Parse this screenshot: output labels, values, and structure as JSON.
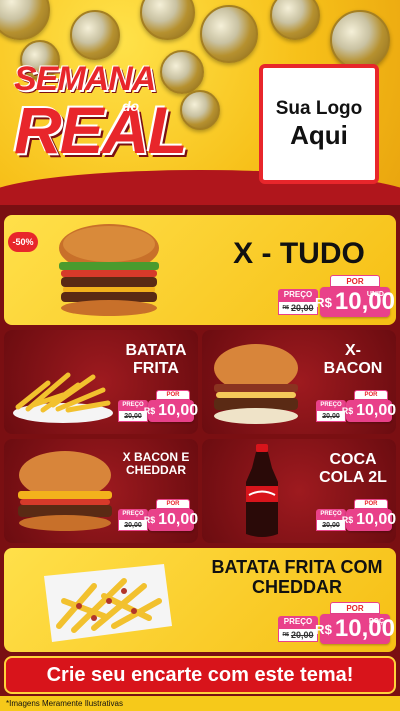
{
  "header": {
    "title_line1": "SEMANA",
    "title_de": "do",
    "title_line2": "REAL",
    "logo_line1": "Sua Logo",
    "logo_line2": "Aqui"
  },
  "products": {
    "xtudo": {
      "name": "X - TUDO",
      "discount": "-50%",
      "label_preco": "PREÇO",
      "label_por": "POR",
      "old_price": "20,00",
      "old_prefix": "R$",
      "new_prefix": "R$",
      "new_price": "10,00",
      "unit": "UNID"
    },
    "batata": {
      "name_line1": "BATATA",
      "name_line2": "FRITA",
      "label_preco": "PREÇO",
      "label_por": "POR",
      "old_price": "20,00",
      "new_prefix": "R$",
      "new_price": "10,00"
    },
    "xbacon": {
      "name_line1": "X-",
      "name_line2": "BACON",
      "label_preco": "PREÇO",
      "label_por": "POR",
      "old_price": "20,00",
      "new_prefix": "R$",
      "new_price": "10,00"
    },
    "xbaconcheddar": {
      "name_line1": "X BACON E",
      "name_line2": "CHEDDAR",
      "label_preco": "PREÇO",
      "label_por": "POR",
      "old_price": "20,00",
      "new_prefix": "R$",
      "new_price": "10,00"
    },
    "coca": {
      "name_line1": "COCA",
      "name_line2": "COLA 2L",
      "label_preco": "PREÇO",
      "label_por": "POR",
      "old_price": "20,00",
      "new_prefix": "R$",
      "new_price": "10,00"
    },
    "batatacheddar": {
      "name_line1": "BATATA FRITA COM",
      "name_line2": "CHEDDAR",
      "label_preco": "PREÇO",
      "label_por": "POR",
      "old_price": "20,00",
      "old_prefix": "R$",
      "new_prefix": "R$",
      "new_price": "10,00",
      "unit": "POÇ"
    }
  },
  "cta": {
    "label": "Crie seu encarte com este tema!"
  },
  "footer": {
    "note": "*Imagens Meramente Ilustrativas"
  },
  "colors": {
    "red": "#d8141b",
    "yellow": "#f6c91a",
    "pink": "#e9418a",
    "dark_red": "#7a0f12"
  }
}
